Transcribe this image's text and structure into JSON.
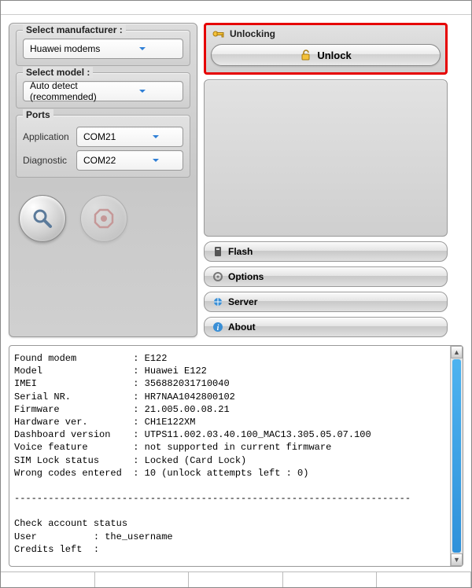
{
  "left": {
    "manufacturer_label": "Select manufacturer :",
    "manufacturer_value": "Huawei modems",
    "model_label": "Select model :",
    "model_value": "Auto detect (recommended)",
    "ports_label": "Ports",
    "app_label": "Application",
    "app_value": "COM21",
    "diag_label": "Diagnostic",
    "diag_value": "COM22"
  },
  "right": {
    "unlocking_header": "Unlocking",
    "unlock_btn": "Unlock",
    "tabs": {
      "flash": "Flash",
      "options": "Options",
      "server": "Server",
      "about": "About"
    }
  },
  "log": "Found modem          : E122\nModel                : Huawei E122\nIMEI                 : 356882031710040\nSerial NR.           : HR7NAA1042800102\nFirmware             : 21.005.00.08.21\nHardware ver.        : CH1E122XM\nDashboard version    : UTPS11.002.03.40.100_MAC13.305.05.07.100\nVoice feature        : not supported in current firmware\nSIM Lock status      : Locked (Card Lock)\nWrong codes entered  : 10 (unlock attempts left : 0)\n\n----------------------------------------------------------------------\n\nCheck account status\nUser          : the_username\nCredits left  :\n"
}
